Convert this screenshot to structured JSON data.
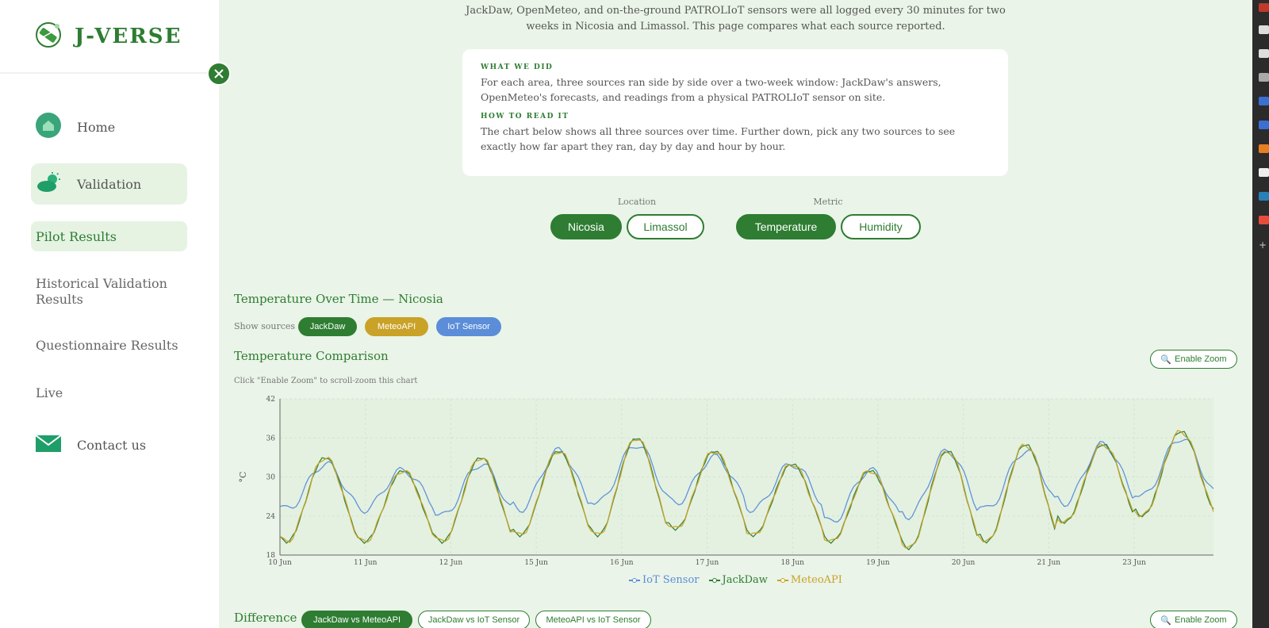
{
  "brand": {
    "name": "J-VERSE"
  },
  "sidebar": {
    "home": "Home",
    "validation": "Validation",
    "pilot_results": "Pilot Results",
    "historical": "Historical Validation Results",
    "questionnaire": "Questionnaire Results",
    "live": "Live",
    "contact": "Contact us"
  },
  "intro": {
    "line1": "JackDaw, OpenMeteo, and on-the-ground PATROLIoT sensors were all logged every 30 minutes for two",
    "line2": "weeks in Nicosia and Limassol. This page compares what each source reported."
  },
  "card": {
    "h1": "WHAT WE DID",
    "p1": "For each area, three sources ran side by side over a two-week window: JackDaw's answers, OpenMeteo's forecasts, and readings from a physical PATROLIoT sensor on site.",
    "h2": "HOW TO READ IT",
    "p2": "The chart below shows all three sources over time. Further down, pick any two sources to see exactly how far apart they ran, day by day and hour by hour."
  },
  "selectors": {
    "location_label": "Location",
    "location_options": [
      "Nicosia",
      "Limassol"
    ],
    "location_selected": "Nicosia",
    "metric_label": "Metric",
    "metric_options": [
      "Temperature",
      "Humidity"
    ],
    "metric_selected": "Temperature"
  },
  "over_time": {
    "title": "Temperature Over Time — Nicosia",
    "show_sources_label": "Show sources",
    "sources": [
      "JackDaw",
      "MeteoAPI",
      "IoT Sensor"
    ]
  },
  "comparison": {
    "title": "Temperature Comparison",
    "zoom_label": "Enable Zoom",
    "hint": "Click \"Enable Zoom\" to scroll-zoom this chart"
  },
  "difference": {
    "title": "Difference",
    "options": [
      "JackDaw vs MeteoAPI",
      "JackDaw vs IoT Sensor",
      "MeteoAPI vs IoT Sensor"
    ],
    "selected": "JackDaw vs MeteoAPI",
    "zoom_label": "Enable Zoom"
  },
  "colors": {
    "accent": "#2e7d32",
    "jackdaw": "#2e7d32",
    "meteo": "#c9a227",
    "iot": "#5b8dd9"
  },
  "chart_data": {
    "type": "line",
    "ylabel": "°C",
    "ylim": [
      18,
      42
    ],
    "yticks": [
      18,
      24,
      30,
      36,
      42
    ],
    "xtick_labels": [
      "10 Jun",
      "11 Jun",
      "12 Jun",
      "15 Jun",
      "16 Jun",
      "17 Jun",
      "18 Jun",
      "19 Jun",
      "20 Jun",
      "21 Jun",
      "23 Jun"
    ],
    "legend_position": "bottom",
    "series": [
      {
        "name": "IoT Sensor",
        "mins": [
          25,
          25,
          24,
          25,
          26,
          26,
          25,
          23,
          24,
          25,
          26,
          27
        ],
        "maxs": [
          32,
          31,
          32,
          34,
          35,
          33,
          32,
          31,
          34,
          34,
          35,
          36
        ]
      },
      {
        "name": "JackDaw",
        "mins": [
          20,
          20,
          20,
          21,
          21,
          22,
          21,
          20,
          19,
          20,
          23,
          24
        ],
        "maxs": [
          33,
          31,
          33,
          34,
          36,
          34,
          32,
          31,
          34,
          35,
          35,
          37
        ]
      },
      {
        "name": "MeteoAPI",
        "mins": [
          20,
          20,
          20,
          21,
          21,
          22,
          21,
          20,
          19,
          20,
          23,
          24
        ],
        "maxs": [
          33,
          31,
          33,
          34,
          36,
          34,
          32,
          31,
          34,
          35,
          35,
          37
        ]
      }
    ]
  }
}
